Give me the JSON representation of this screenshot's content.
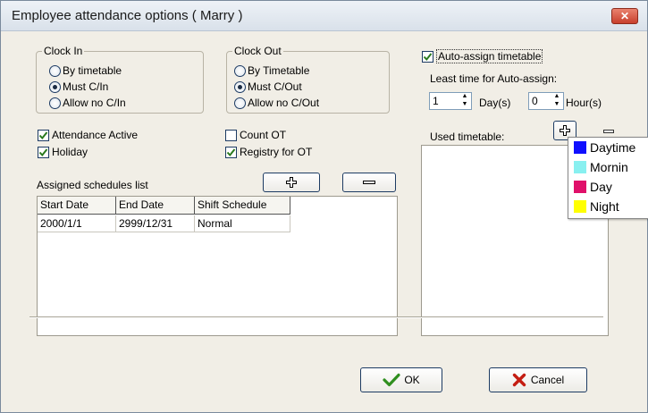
{
  "window": {
    "title": "Employee attendance options ( Marry )",
    "close_label": "✕"
  },
  "clock_in": {
    "label": "Clock In",
    "options": [
      "By timetable",
      "Must C/In",
      "Allow no C/In"
    ],
    "selected_index": 1
  },
  "clock_out": {
    "label": "Clock Out",
    "options": [
      "By Timetable",
      "Must C/Out",
      "Allow no C/Out"
    ],
    "selected_index": 1
  },
  "checks": {
    "attendance_active": {
      "label": "Attendance Active",
      "checked": true
    },
    "holiday": {
      "label": "Holiday",
      "checked": true
    },
    "count_ot": {
      "label": "Count OT",
      "checked": false
    },
    "registry_ot": {
      "label": "Registry for OT",
      "checked": true
    }
  },
  "schedules": {
    "label": "Assigned schedules list",
    "add_icon": "plus-icon",
    "remove_icon": "minus-icon",
    "columns": [
      "Start Date",
      "End Date",
      "Shift Schedule"
    ],
    "rows": [
      [
        "2000/1/1",
        "2999/12/31",
        "Normal"
      ]
    ]
  },
  "auto_assign": {
    "label": "Auto-assign timetable",
    "checked": true,
    "least_time_label": "Least time for Auto-assign:",
    "day_value": "1",
    "day_unit": "Day(s)",
    "hour_value": "0",
    "hour_unit": "Hour(s)"
  },
  "used_timetable": {
    "label": "Used timetable:",
    "add_icon": "plus-icon"
  },
  "timetable_menu": {
    "items": [
      {
        "label": "Daytime",
        "color": "#1010ff"
      },
      {
        "label": "Mornin",
        "color": "#88f0f0"
      },
      {
        "label": "Day",
        "color": "#e0106a"
      },
      {
        "label": "Night",
        "color": "#ffff00"
      }
    ]
  },
  "footer": {
    "ok_label": "OK",
    "cancel_label": "Cancel",
    "ok_icon": "check-icon",
    "cancel_icon": "cross-icon"
  }
}
